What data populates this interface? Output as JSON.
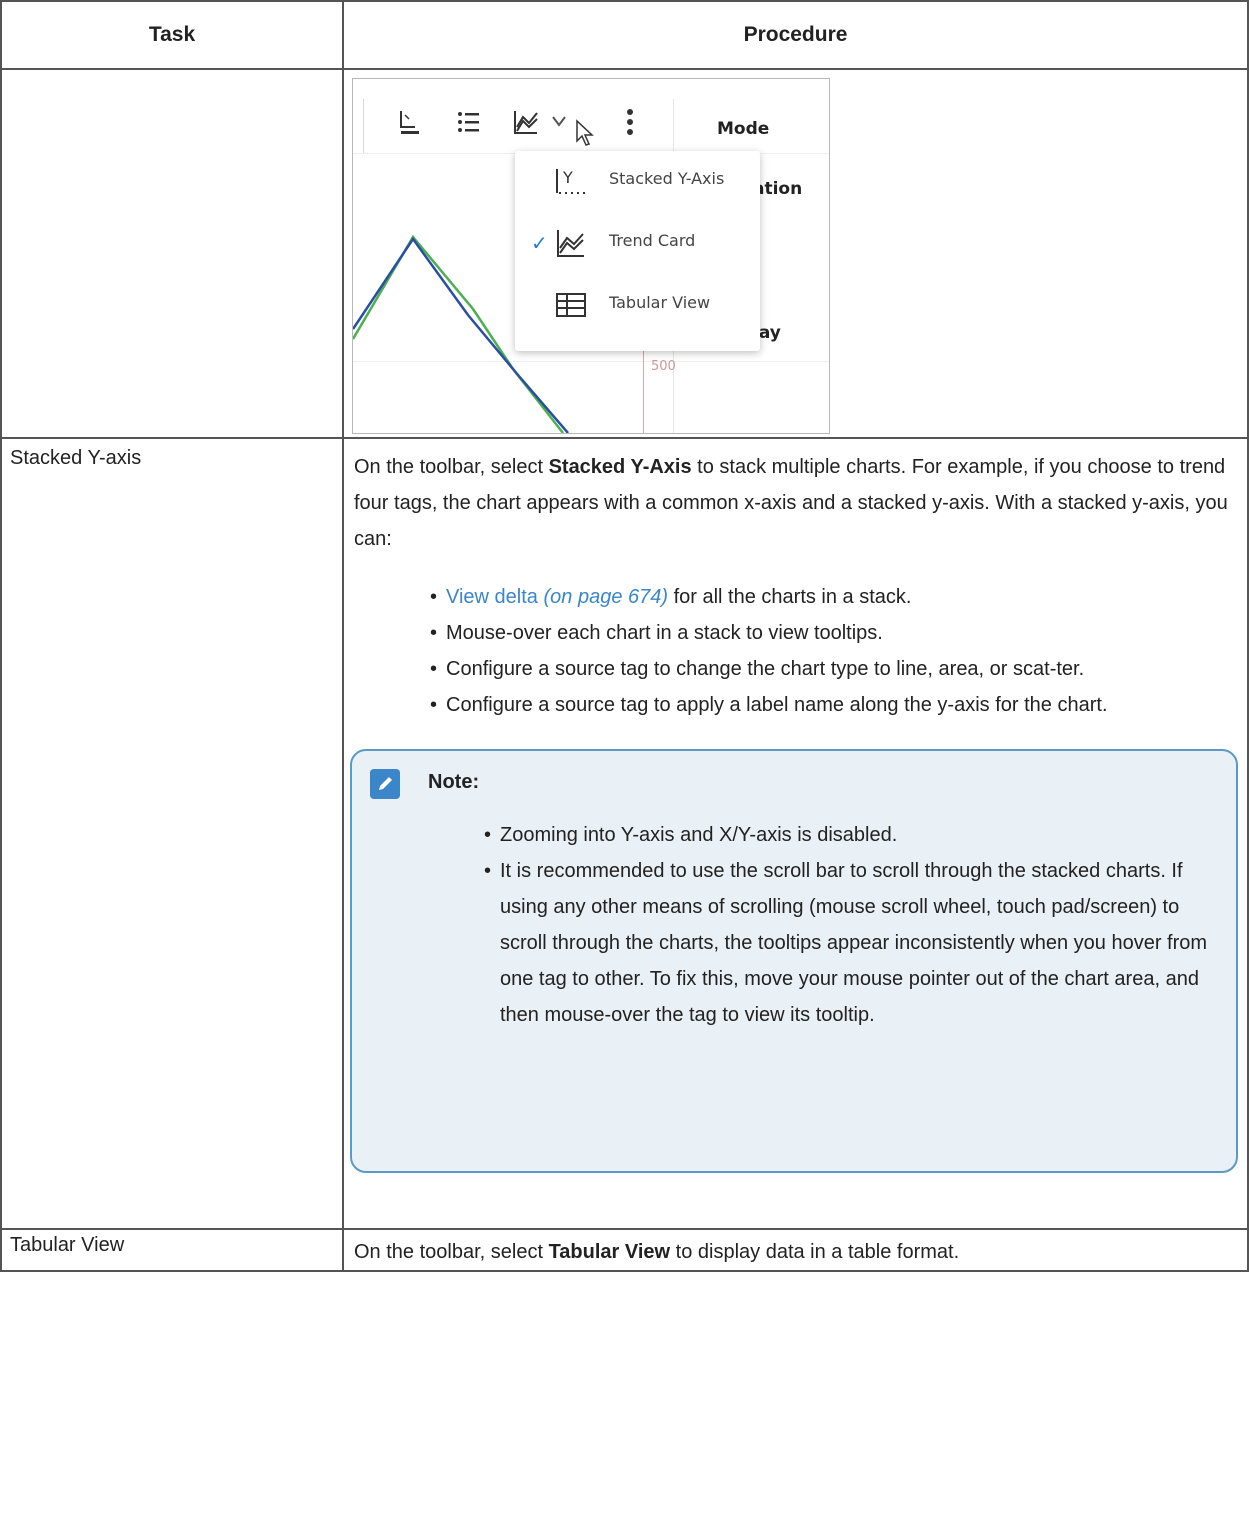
{
  "table": {
    "headers": {
      "task": "Task",
      "procedure": "Procedure"
    },
    "figure": {
      "mode_label": "Mode",
      "ation_label": "ation",
      "lay_label": "lay",
      "axis_number": "500",
      "menu_items": [
        {
          "label": "Stacked Y-Axis",
          "icon": "stacked-y-axis-icon",
          "checked": false
        },
        {
          "label": "Trend Card",
          "icon": "trend-card-icon",
          "checked": true
        },
        {
          "label": "Tabular View",
          "icon": "tabular-view-icon",
          "checked": false
        }
      ],
      "accent": "#2b7bd8"
    },
    "rows": [
      {
        "task": "Stacked Y-axis",
        "intro_pre": "On the toolbar, select ",
        "intro_bold": "Stacked Y-Axis",
        "intro_post": " to stack multiple charts. For example, if you choose to trend four tags, the chart appears with a common x-axis and a stacked y-axis. With a stacked y-axis, you can:",
        "bullet1_link": "View delta",
        "bullet1_ref": "(on page 674)",
        "bullet1_rest": " for all the charts in a stack.",
        "bullets": [
          "Mouse-over each chart in a stack to view tooltips.",
          "Configure a source tag to change the chart type to line, area, or scat-ter.",
          "Configure a source tag to apply a label name along the y-axis for the chart."
        ],
        "note": {
          "title": "Note:",
          "items": [
            "Zooming into Y-axis and X/Y-axis is disabled.",
            "It is recommended to use the scroll bar to scroll through the stacked charts. If using any other means of scrolling (mouse scroll wheel, touch pad/screen) to scroll through the charts, the tooltips appear inconsistently when you hover from one tag to other. To fix this, move your mouse pointer out of the chart area, and then mouse-over the tag to view its tooltip."
          ]
        }
      },
      {
        "task": "Tabular View",
        "intro_pre": "On the toolbar, select ",
        "intro_bold": "Tabular View",
        "intro_post": " to display data in a table format."
      }
    ]
  }
}
